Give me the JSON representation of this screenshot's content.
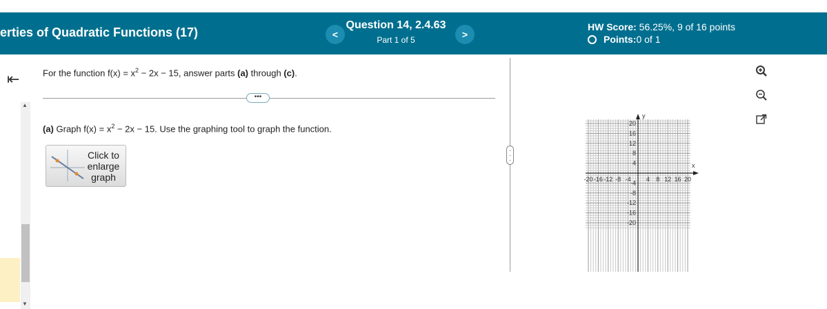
{
  "header": {
    "assignment_title": "erties of Quadratic Functions (17)",
    "prev_label": "<",
    "next_label": ">",
    "question_title": "Question 14, 2.4.63",
    "question_part": "Part 1 of 5",
    "hw_score_label": "HW Score:",
    "hw_score_value": " 56.25%, 9 of 16 points",
    "points_label": "Points:",
    "points_value": " 0 of 1"
  },
  "sidebar": {
    "collapse_icon": "collapse-left-icon"
  },
  "question": {
    "prompt_pre": "For the function f(x) = x",
    "prompt_exp": "2",
    "prompt_mid": " − 2x − 15, answer parts ",
    "prompt_a": "(a)",
    "prompt_through": " through ",
    "prompt_c": "(c)",
    "prompt_end": ".",
    "more_label": "•••",
    "part_a_label": "(a)",
    "part_a_pre": " Graph f(x) = x",
    "part_a_exp": "2",
    "part_a_post": " − 2x − 15. Use the graphing tool to graph the function.",
    "enlarge_label_1": "Click to",
    "enlarge_label_2": "enlarge",
    "enlarge_label_3": "graph"
  },
  "graph": {
    "xlim": [
      -20,
      20
    ],
    "ylim": [
      -20,
      20
    ],
    "x_axis_label": "x",
    "y_axis_label": "y",
    "x_ticks": [
      "-20",
      "-16",
      "-12",
      "-8",
      "-4",
      "4",
      "8",
      "12",
      "16",
      "20"
    ],
    "y_ticks": [
      "20",
      "16",
      "12",
      "8",
      "4",
      "-4",
      "-8",
      "-12",
      "-16",
      "-20"
    ]
  },
  "tools": {
    "zoom_in": "zoom-in-icon",
    "zoom_out": "zoom-out-icon",
    "popout": "external-link-icon"
  },
  "colors": {
    "header_bg": "#006f8f",
    "nav_button": "#1c8db0"
  }
}
